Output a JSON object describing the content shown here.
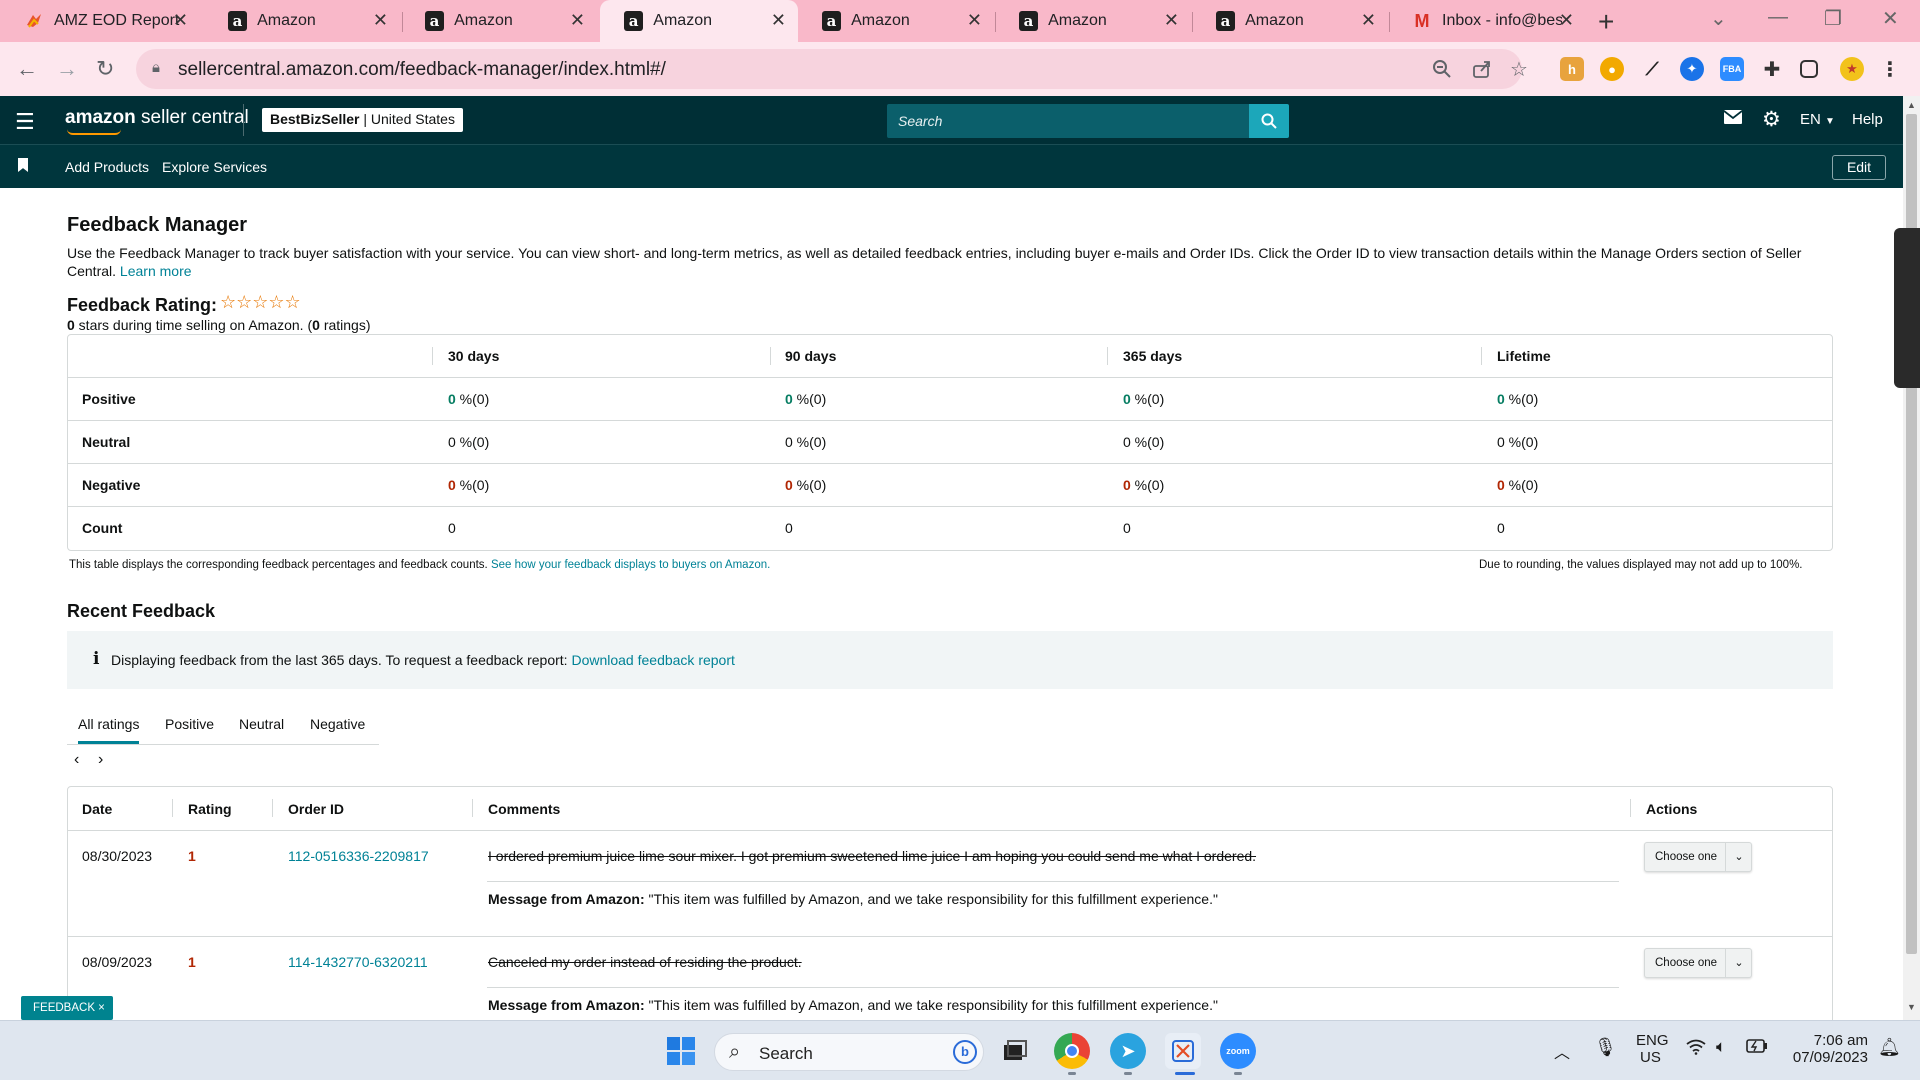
{
  "browser": {
    "tabs": [
      {
        "title": "AMZ EOD Report",
        "icon": "eod-report-icon",
        "active": false
      },
      {
        "title": "Amazon",
        "icon": "amazon-a-icon",
        "active": false
      },
      {
        "title": "Amazon",
        "icon": "amazon-a-icon",
        "active": false
      },
      {
        "title": "Amazon",
        "icon": "amazon-a-icon",
        "active": true
      },
      {
        "title": "Amazon",
        "icon": "amazon-a-icon",
        "active": false
      },
      {
        "title": "Amazon",
        "icon": "amazon-a-icon",
        "active": false
      },
      {
        "title": "Amazon",
        "icon": "amazon-a-icon",
        "active": false
      },
      {
        "title": "Inbox - info@bes",
        "icon": "gmail-icon",
        "active": false
      }
    ],
    "url": "sellercentral.amazon.com/feedback-manager/index.html#/",
    "colors": {
      "tabbar": "#f9b8c9",
      "toolbar": "#fde7ee"
    }
  },
  "header": {
    "logo_brand": "amazon",
    "logo_product": " seller central",
    "store_name": "BestBizSeller",
    "store_region": "United States",
    "search_placeholder": "Search",
    "language": "EN",
    "help": "Help",
    "colors": {
      "top": "#002f36",
      "accent": "#1ca7ba"
    }
  },
  "subnav": {
    "links": [
      "Add Products",
      "Explore Services"
    ],
    "edit": "Edit"
  },
  "page": {
    "title": "Feedback Manager",
    "intro": "Use the Feedback Manager to track buyer satisfaction with your service. You can view short- and long-term metrics, as well as detailed feedback entries, including buyer e-mails and Order IDs. Click the Order ID to view transaction details within the Manage Orders section of Seller Central.",
    "learn_more": "Learn more",
    "rating_label": "Feedback Rating:",
    "stars": "☆☆☆☆☆",
    "rating_count_stars": "0",
    "rating_sub_mid": " stars during time selling on Amazon. (",
    "rating_count": "0",
    "rating_sub_end": " ratings)"
  },
  "feedback_table": {
    "columns": [
      "30 days",
      "90 days",
      "365 days",
      "Lifetime"
    ],
    "rows": [
      {
        "label": "Positive",
        "cells": [
          {
            "num": "0",
            "rest": " %(0)"
          },
          {
            "num": "0",
            "rest": " %(0)"
          },
          {
            "num": "0",
            "rest": " %(0)"
          },
          {
            "num": "0",
            "rest": " %(0)"
          }
        ]
      },
      {
        "label": "Neutral",
        "cells": [
          {
            "num": "0",
            "rest": " %(0)"
          },
          {
            "num": "0",
            "rest": " %(0)"
          },
          {
            "num": "0",
            "rest": " %(0)"
          },
          {
            "num": "0",
            "rest": " %(0)"
          }
        ]
      },
      {
        "label": "Negative",
        "cells": [
          {
            "num": "0",
            "rest": " %(0)"
          },
          {
            "num": "0",
            "rest": " %(0)"
          },
          {
            "num": "0",
            "rest": " %(0)"
          },
          {
            "num": "0",
            "rest": " %(0)"
          }
        ]
      },
      {
        "label": "Count",
        "cells": [
          {
            "num": "0",
            "rest": ""
          },
          {
            "num": "0",
            "rest": ""
          },
          {
            "num": "0",
            "rest": ""
          },
          {
            "num": "0",
            "rest": ""
          }
        ]
      }
    ],
    "note": "This table displays the corresponding feedback percentages and feedback counts.",
    "note_link": "See how your feedback displays to buyers on Amazon.",
    "rounding_note": "Due to rounding, the values displayed may not add up to 100%."
  },
  "recent": {
    "title": "Recent Feedback",
    "info_text": "Displaying feedback from the last 365 days. To request a feedback report:",
    "info_link": "Download feedback report",
    "filter_tabs": [
      "All ratings",
      "Positive",
      "Neutral",
      "Negative"
    ],
    "active_filter": "All ratings",
    "columns": [
      "Date",
      "Rating",
      "Order ID",
      "Comments",
      "Actions"
    ],
    "rows": [
      {
        "date": "08/30/2023",
        "rating": "1",
        "order_id": "112-0516336-2209817",
        "comment": "I ordered premium juice lime sour mixer. I got premium sweetened lime juice I am hoping you could send me what I ordered.",
        "message_label": "Message from Amazon:",
        "message": " \"This item was fulfilled by Amazon, and we take responsibility for this fulfillment experience.\"",
        "action": "Choose one"
      },
      {
        "date": "08/09/2023",
        "rating": "1",
        "order_id": "114-1432770-6320211",
        "comment": "Canceled my order instead of residing the product.",
        "message_label": "Message from Amazon:",
        "message": " \"This item was fulfilled by Amazon, and we take responsibility for this fulfillment experience.\"",
        "action": "Choose one"
      }
    ]
  },
  "feedback_pill": "FEEDBACK ×",
  "taskbar": {
    "search": "Search",
    "lang_top": "ENG",
    "lang_bottom": "US",
    "time": "7:06 am",
    "date": "07/09/2023"
  }
}
